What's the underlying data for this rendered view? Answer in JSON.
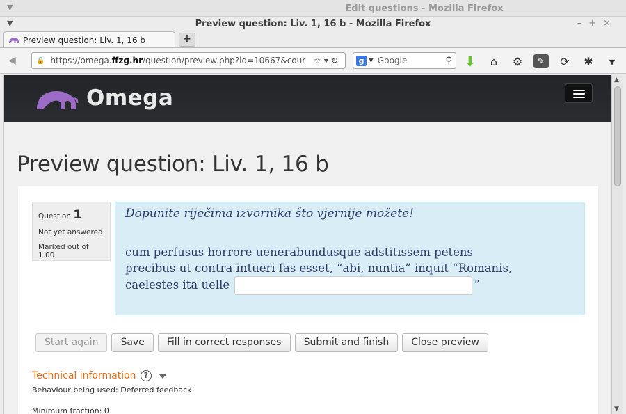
{
  "background_window": {
    "title": "Edit questions - Mozilla Firefox"
  },
  "window": {
    "title": "Preview question: Liv. 1, 16 b - Mozilla Firefox",
    "controls": [
      "–",
      "+",
      "×"
    ]
  },
  "tab": {
    "label": "Preview question: Liv. 1, 16 b"
  },
  "url": {
    "prefix": "https://omega.",
    "domain": "ffzg.hr",
    "path": "/question/preview.php?id=10667&cour"
  },
  "search": {
    "placeholder": "Google"
  },
  "site": {
    "brand": "Omega"
  },
  "page": {
    "title": "Preview question: Liv. 1, 16 b"
  },
  "question_info": {
    "label": "Question",
    "number": "1",
    "state": "Not yet answered",
    "mark": "Marked out of 1.00"
  },
  "question": {
    "instruction": "Dopunite riječima izvornika što vjernije možete!",
    "line1": "cum perfusus horrore uenerabundusque adstitissem petens",
    "line2": "precibus ut contra intueri fas esset, “abi, nuntia” inquit “Romanis,",
    "line3_before": "caelestes ita uelle",
    "line3_after": "”",
    "answer_value": ""
  },
  "buttons": {
    "start_again": "Start again",
    "save": "Save",
    "fill_correct": "Fill in correct responses",
    "submit_finish": "Submit and finish",
    "close_preview": "Close preview"
  },
  "technical": {
    "heading": "Technical information",
    "behaviour": "Behaviour being used: Deferred feedback",
    "min_fraction": "Minimum fraction: 0"
  },
  "colors": {
    "accent_link": "#e8701a",
    "question_box": "#d9edf7",
    "header_bg": "#2b2d31",
    "logo_purple": "#9b6bc6"
  }
}
